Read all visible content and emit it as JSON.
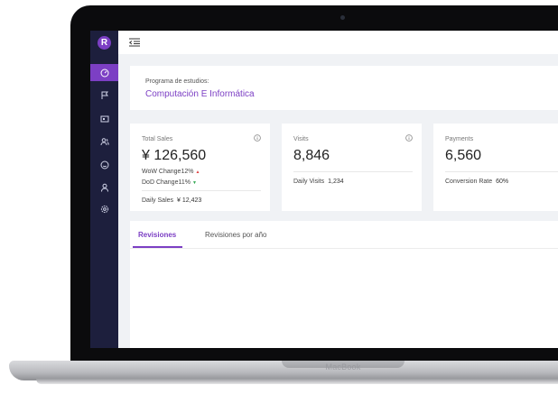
{
  "app": {
    "logo_letter": "R",
    "device_label": "MacBook"
  },
  "sidebar": {
    "items": [
      {
        "icon": "dashboard-icon",
        "active": true
      },
      {
        "icon": "flag-icon"
      },
      {
        "icon": "id-card-icon"
      },
      {
        "icon": "users-icon"
      },
      {
        "icon": "smile-icon"
      },
      {
        "icon": "user-icon"
      },
      {
        "icon": "settings-icon"
      }
    ]
  },
  "program": {
    "label": "Programa de estudios:",
    "name": "Computación E Informática"
  },
  "cards": {
    "sales": {
      "title": "Total Sales",
      "value": "¥ 126,560",
      "wow": "WoW Change12%",
      "dod": "DoD Change11%",
      "foot_label": "Daily Sales",
      "foot_value": "¥ 12,423"
    },
    "visits": {
      "title": "Visits",
      "value": "8,846",
      "foot_label": "Daily Visits",
      "foot_value": "1,234"
    },
    "payments": {
      "title": "Payments",
      "value": "6,560",
      "foot_label": "Conversion Rate",
      "foot_value": "60%"
    }
  },
  "tabs": [
    {
      "label": "Revisiones",
      "active": true
    },
    {
      "label": "Revisiones por año"
    }
  ],
  "colors": {
    "accent": "#7c3fc4",
    "sidebar": "#1d1f3d",
    "up": "#e04545",
    "down": "#32a852"
  }
}
